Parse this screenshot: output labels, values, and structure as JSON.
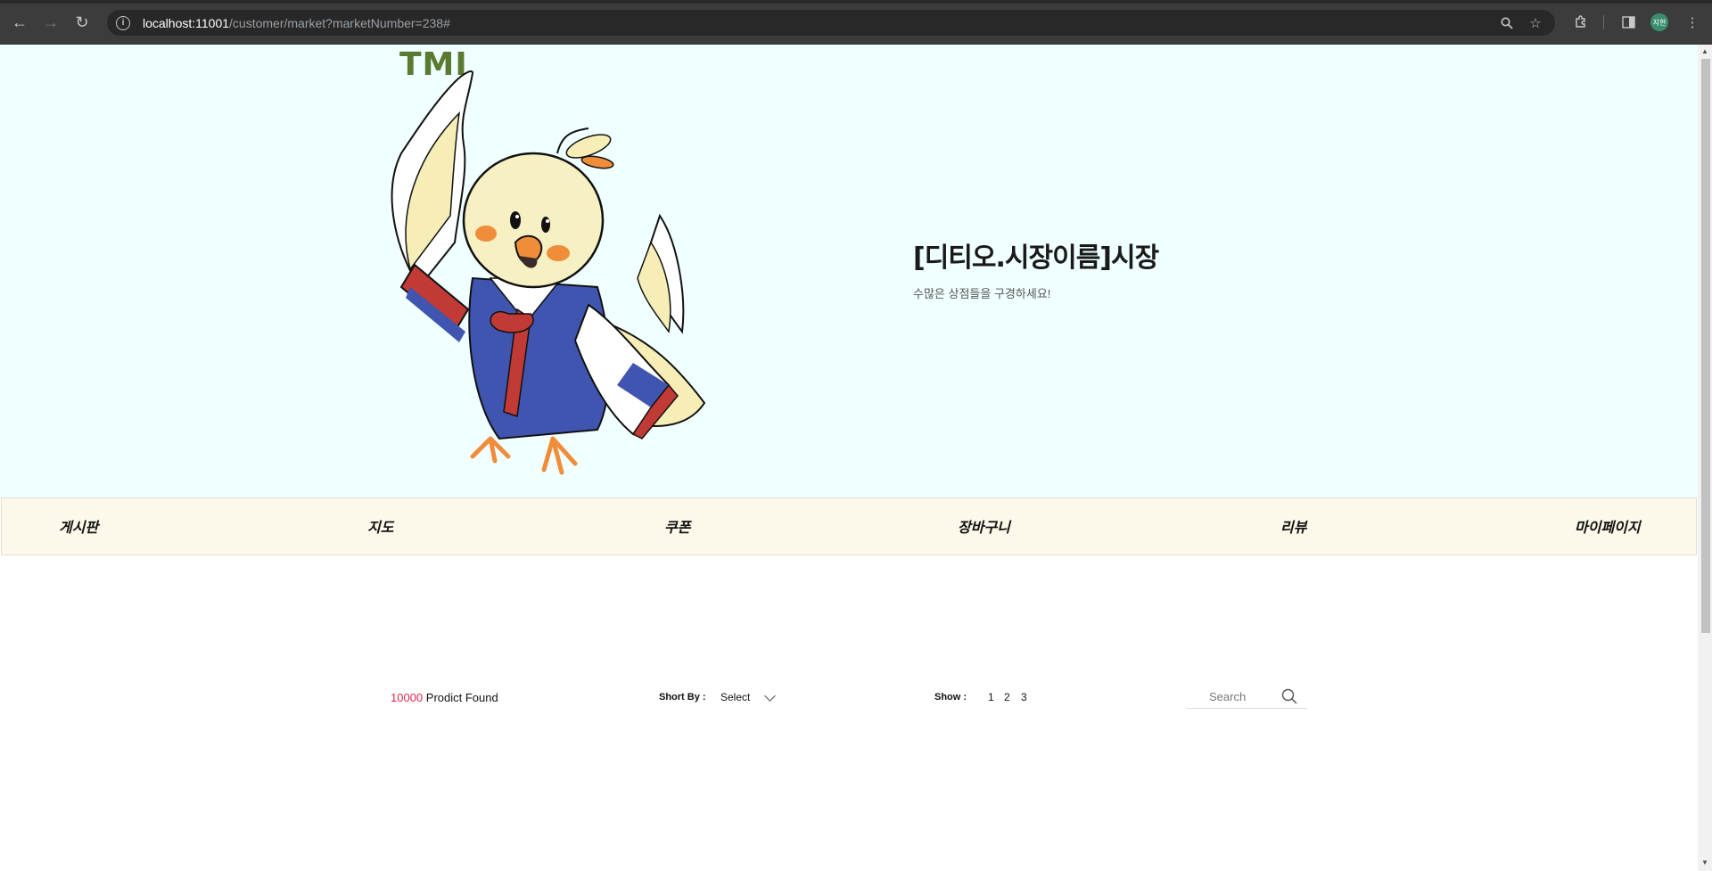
{
  "browser": {
    "url_host": "localhost:11001",
    "url_path": "/customer/market?marketNumber=238#",
    "profile_initials": "지현",
    "icons": [
      "back-icon",
      "forward-icon",
      "reload-icon",
      "site-info-icon",
      "zoom-icon",
      "bookmark-star-icon",
      "extensions-icon",
      "side-panel-icon",
      "menu-kebab-icon"
    ]
  },
  "hero": {
    "logo": "TMI",
    "title": "[디티오.시장이름]시장",
    "subtitle": "수많은 상점들을 구경하세요!"
  },
  "menu": {
    "items": [
      "게시판",
      "지도",
      "쿠폰",
      "장바구니",
      "리뷰",
      "마이페이지"
    ]
  },
  "toolbar": {
    "count": "10000",
    "found_label": "Prodict Found",
    "sort_label": "Short By :",
    "sort_value": "Select",
    "show_label": "Show :",
    "pages": [
      "1",
      "2",
      "3"
    ],
    "search_placeholder": "Search"
  },
  "colors": {
    "hero_bg": "#f0ffff",
    "menu_bg": "#fdf9ea",
    "logo": "#5a7a32",
    "count": "#e0294a"
  }
}
